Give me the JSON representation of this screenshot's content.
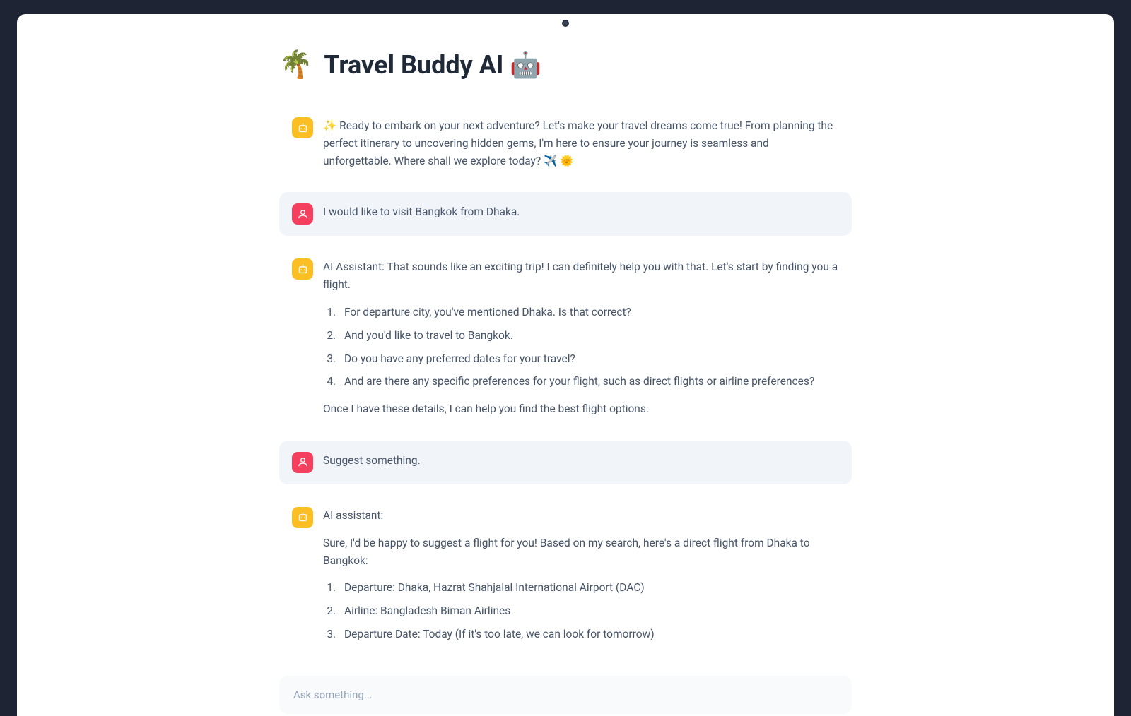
{
  "header": {
    "palm_emoji": "🌴",
    "title": "Travel Buddy AI",
    "robot_emoji": "🤖"
  },
  "messages": [
    {
      "role": "ai",
      "intro": "✨ Ready to embark on your next adventure? Let's make your travel dreams come true! From planning the perfect itinerary to uncovering hidden gems, I'm here to ensure your journey is seamless and unforgettable. Where shall we explore today? ✈️ 🌞"
    },
    {
      "role": "user",
      "text": "I would like to visit Bangkok from Dhaka."
    },
    {
      "role": "ai",
      "intro": "AI Assistant: That sounds like an exciting trip! I can definitely help you with that. Let's start by finding you a flight.",
      "list": [
        "For departure city, you've mentioned Dhaka. Is that correct?",
        "And you'd like to travel to Bangkok.",
        "Do you have any preferred dates for your travel?",
        "And are there any specific preferences for your flight, such as direct flights or airline preferences?"
      ],
      "outro": "Once I have these details, I can help you find the best flight options."
    },
    {
      "role": "user",
      "text": "Suggest something."
    },
    {
      "role": "ai",
      "intro": "AI assistant:",
      "intro2": "Sure, I'd be happy to suggest a flight for you! Based on my search, here's a direct flight from Dhaka to Bangkok:",
      "list": [
        "Departure: Dhaka, Hazrat Shahjalal International Airport (DAC)",
        "Airline: Bangladesh Biman Airlines",
        "Departure Date: Today (If it's too late, we can look for tomorrow)"
      ]
    }
  ],
  "input": {
    "placeholder": "Ask something..."
  }
}
